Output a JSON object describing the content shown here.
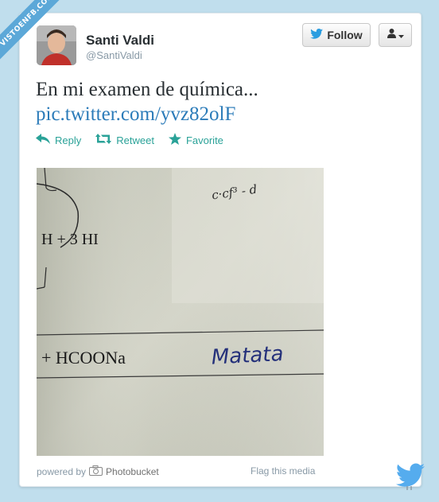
{
  "watermark": "VISTOENFB.COM",
  "user": {
    "display_name": "Santi Valdi",
    "screen_name": "@SantiValdi"
  },
  "follow_label": "Follow",
  "tweet": {
    "text": "En mi examen de química...",
    "link": "pic.twitter.com/yvz82olF"
  },
  "actions": {
    "reply": "Reply",
    "retweet": "Retweet",
    "favorite": "Favorite"
  },
  "media": {
    "line1": "H  +  3 HI",
    "line2": "+  HCOONa",
    "handwriting": "Matata",
    "corner_note": "c·cf³ - d"
  },
  "footer": {
    "powered_by": "powered by",
    "provider": "Photobucket",
    "flag": "Flag this media"
  },
  "colors": {
    "background": "#c0deed",
    "link": "#2b7bb9",
    "action": "#2aa298"
  }
}
